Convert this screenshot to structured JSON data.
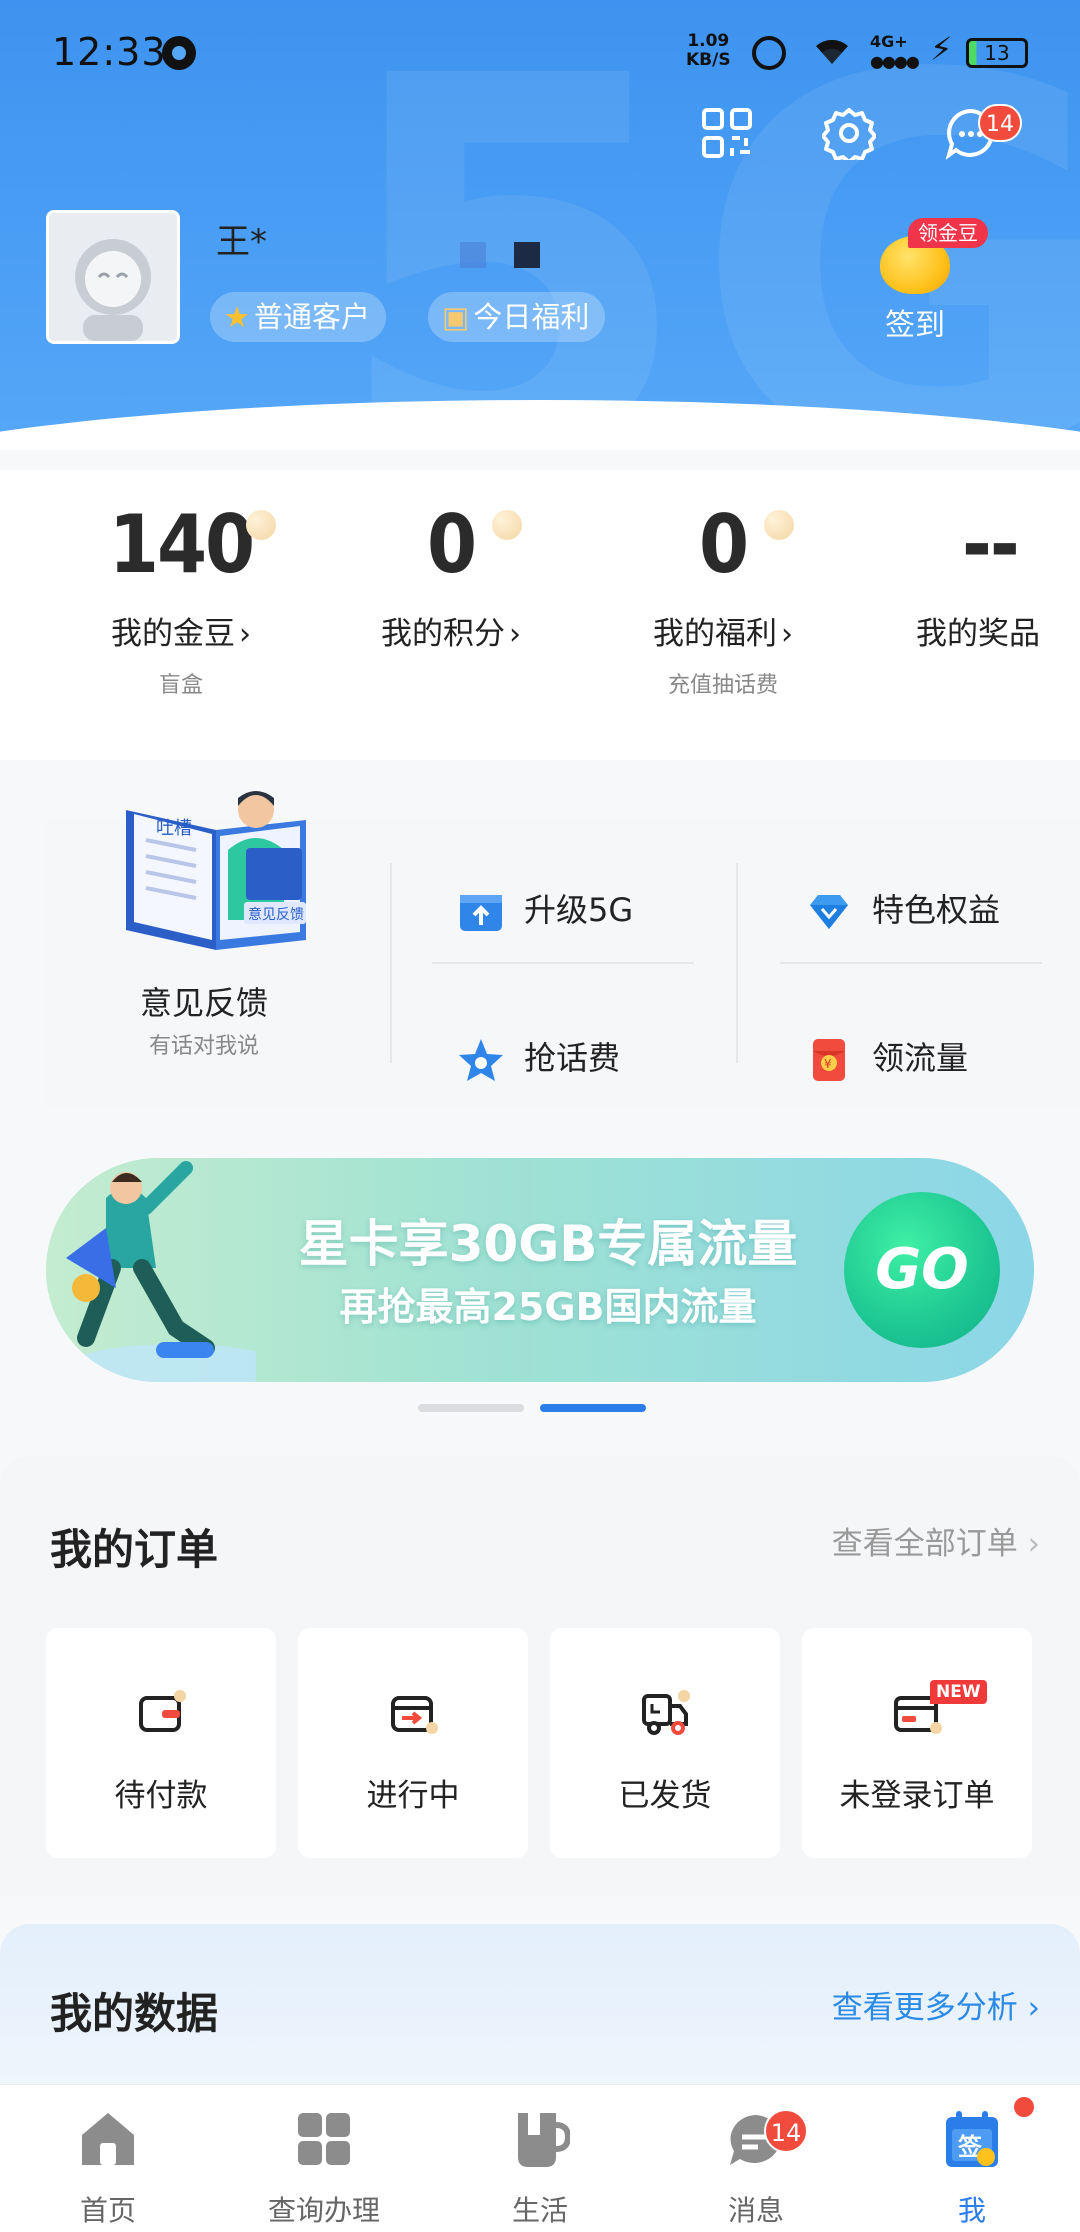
{
  "status_bar": {
    "time": "12:33",
    "speed_value": "1.09",
    "speed_unit": "KB/S",
    "network": "4G+",
    "battery": "13"
  },
  "header": {
    "user_name": "王*",
    "level_tag": "普通客户",
    "benefit_tag": "今日福利",
    "signin_tag": "领金豆",
    "signin_label": "签到",
    "message_badge": "14"
  },
  "stats": [
    {
      "value": "140",
      "label": "我的金豆",
      "sub": "盲盒"
    },
    {
      "value": "0",
      "label": "我的积分",
      "sub": ""
    },
    {
      "value": "0",
      "label": "我的福利",
      "sub": "充值抽话费"
    },
    {
      "value": "--",
      "label": "我的奖品",
      "sub": ""
    }
  ],
  "quick": {
    "feedback_title": "意见反馈",
    "feedback_sub": "有话对我说",
    "book_label": "意见反馈",
    "book_cover": "吐槽",
    "items": [
      {
        "label": "升级5G",
        "icon": "upgrade-icon"
      },
      {
        "label": "特色权益",
        "icon": "diamond-icon"
      },
      {
        "label": "抢话费",
        "icon": "star-icon"
      },
      {
        "label": "领流量",
        "icon": "red-packet-icon"
      }
    ]
  },
  "banner": {
    "main": "星卡享30GB专属流量",
    "sub": "再抢最高25GB国内流量",
    "button": "GO",
    "page_count": 2,
    "active_page": 2
  },
  "orders": {
    "title": "我的订单",
    "more": "查看全部订单",
    "items": [
      {
        "label": "待付款",
        "icon": "wallet-icon"
      },
      {
        "label": "进行中",
        "icon": "box-arrow-icon"
      },
      {
        "label": "已发货",
        "icon": "truck-icon"
      },
      {
        "label": "未登录订单",
        "icon": "card-icon",
        "badge": "NEW"
      }
    ]
  },
  "mydata": {
    "title": "我的数据",
    "more": "查看更多分析"
  },
  "tabbar": {
    "items": [
      {
        "label": "首页",
        "icon": "home-icon"
      },
      {
        "label": "查询办理",
        "icon": "grid-icon"
      },
      {
        "label": "生活",
        "icon": "cup-icon"
      },
      {
        "label": "消息",
        "icon": "chat-icon",
        "badge": "14"
      },
      {
        "label": "我",
        "icon": "calendar-sign-icon"
      }
    ],
    "active_index": 4
  },
  "colors": {
    "header_blue": "#3d93ef",
    "accent_blue": "#2b7de9",
    "badge_red": "#f04b3c",
    "go_green": "#1dc792"
  }
}
